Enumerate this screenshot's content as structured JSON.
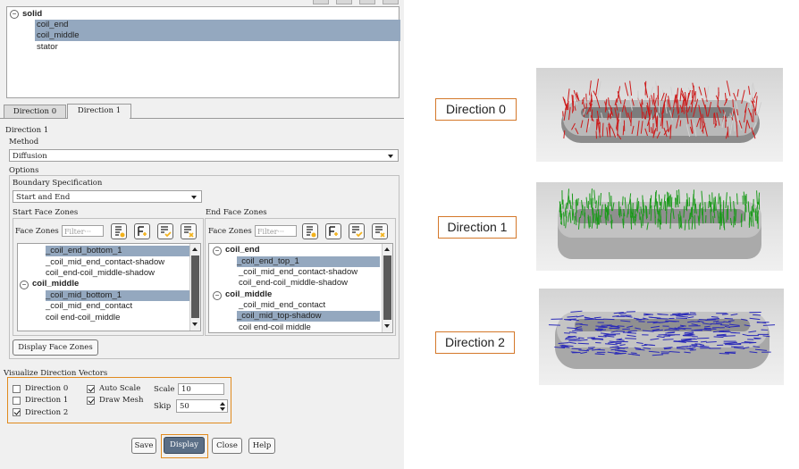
{
  "zone_tree": {
    "root_label": "solid",
    "children": [
      "coil_end",
      "coil_middle",
      "stator"
    ],
    "selected": [
      "coil_end",
      "coil_middle"
    ]
  },
  "tabs": [
    {
      "label": "Direction 0",
      "active": false
    },
    {
      "label": "Direction 1",
      "active": true
    }
  ],
  "direction_section": {
    "title": "Direction 1",
    "method_label": "Method",
    "method_value": "Diffusion",
    "options_label": "Options",
    "boundary_spec_label": "Boundary Specification",
    "boundary_spec_value": "Start and End"
  },
  "start_zones": {
    "title": "Start Face Zones",
    "face_zones_label": "Face Zones",
    "filter_placeholder": "Filter···",
    "items": [
      {
        "text": "_coil_end_bottom_1",
        "selected": true
      },
      {
        "text": "_coil_mid_end_contact-shadow",
        "selected": false
      },
      {
        "text": "coil_end-coil_middle-shadow",
        "selected": false
      },
      {
        "text": "coil_middle",
        "selected": false,
        "group": true
      },
      {
        "text": "_coil_mid_bottom_1",
        "selected": true
      },
      {
        "text": "_coil_mid_end_contact",
        "selected": false
      },
      {
        "text": "coil end-coil_middle",
        "selected": false
      }
    ]
  },
  "end_zones": {
    "title": "End Face Zones",
    "face_zones_label": "Face Zones",
    "filter_placeholder": "Filter···",
    "items": [
      {
        "text": "coil_end",
        "selected": false,
        "group": true
      },
      {
        "text": "_coil_end_top_1",
        "selected": true
      },
      {
        "text": "_coil_mid_end_contact-shadow",
        "selected": false
      },
      {
        "text": "coil_end-coil_middle-shadow",
        "selected": false
      },
      {
        "text": "coil_middle",
        "selected": false,
        "group": true
      },
      {
        "text": "_coil_mid_end_contact",
        "selected": false
      },
      {
        "text": "_coil_mid_top-shadow",
        "selected": true
      },
      {
        "text": "coil end-coil middle",
        "selected": false
      }
    ]
  },
  "display_face_zones_label": "Display Face Zones",
  "visualize": {
    "title": "Visualize Direction Vectors",
    "dir0_label": "Direction 0",
    "dir0_checked": false,
    "dir1_label": "Direction 1",
    "dir1_checked": false,
    "dir2_label": "Direction 2",
    "dir2_checked": true,
    "auto_scale_label": "Auto Scale",
    "auto_scale_checked": true,
    "draw_mesh_label": "Draw Mesh",
    "draw_mesh_checked": true,
    "scale_label": "Scale",
    "scale_value": "10",
    "skip_label": "Skip",
    "skip_value": "50"
  },
  "buttons": {
    "save": "Save",
    "display": "Display",
    "close": "Close",
    "help": "Help"
  },
  "previews": [
    {
      "label": "Direction 0",
      "arrow_color": "#cc1a1a"
    },
    {
      "label": "Direction 1",
      "arrow_color": "#1a9a1a"
    },
    {
      "label": "Direction 2",
      "arrow_color": "#2a2ab8"
    }
  ],
  "colors": {
    "accent": "#e08a1e",
    "selection": "#94a8bf",
    "display_button": "#5a6e86"
  }
}
